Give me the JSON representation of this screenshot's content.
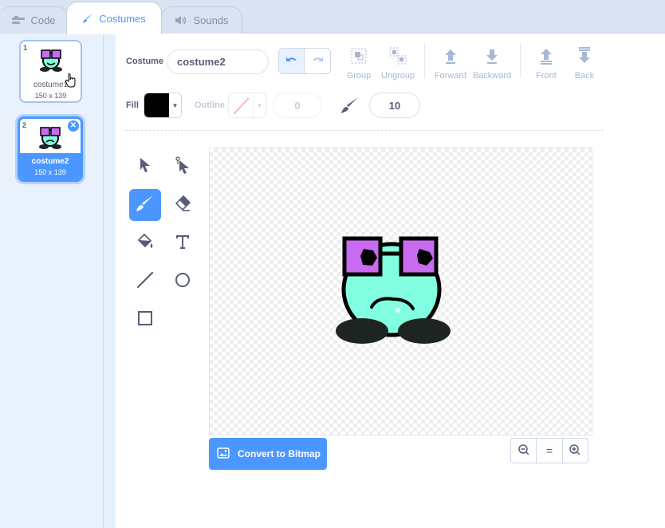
{
  "tabs": {
    "code": "Code",
    "costumes": "Costumes",
    "sounds": "Sounds"
  },
  "costumes": [
    {
      "number": "1",
      "name": "costume1",
      "size": "150 x 139"
    },
    {
      "number": "2",
      "name": "costume2",
      "size": "150 x 139"
    }
  ],
  "toolbar": {
    "costume_label": "Costume",
    "costume_name": "costume2",
    "group": "Group",
    "ungroup": "Ungroup",
    "forward": "Forward",
    "backward": "Backward",
    "front": "Front",
    "back": "Back"
  },
  "style_bar": {
    "fill_label": "Fill",
    "fill_color": "#000000",
    "outline_label": "Outline",
    "outline_width": "0",
    "brush_size": "10"
  },
  "canvas": {
    "convert_button": "Convert to Bitmap",
    "zoom_reset": "="
  },
  "colors": {
    "accent": "#4c97ff",
    "character_body": "#82ffe1",
    "glasses": "#c96bf0"
  }
}
